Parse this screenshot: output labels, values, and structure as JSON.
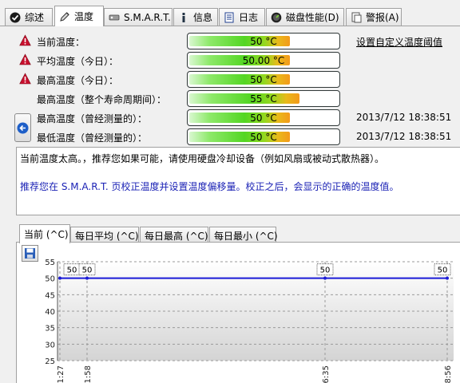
{
  "tabs": [
    {
      "label": "综述",
      "icon": "check-circle-icon",
      "active": false
    },
    {
      "label": "温度",
      "icon": "pencil-icon",
      "active": true
    },
    {
      "label": "S.M.A.R.T.",
      "icon": "drive-icon",
      "active": false
    },
    {
      "label": "信息",
      "icon": "info-icon",
      "active": false
    },
    {
      "label": "日志",
      "icon": "log-icon",
      "active": false
    },
    {
      "label": "磁盘性能(D)",
      "icon": "gauge-icon",
      "active": false
    },
    {
      "label": "警报(A)",
      "icon": "alert-doc-icon",
      "active": false
    }
  ],
  "temperatures": [
    {
      "label": "当前温度：",
      "value": "50 °C",
      "level": 0.68,
      "warning": true,
      "timestamp": ""
    },
    {
      "label": "平均温度（今日）：",
      "value": "50.00 °C",
      "level": 0.68,
      "warning": true,
      "timestamp": ""
    },
    {
      "label": "最高温度（今日）：",
      "value": "50 °C",
      "level": 0.68,
      "warning": true,
      "timestamp": ""
    },
    {
      "label": "最高温度（整个寿命周期间）：",
      "value": "55 °C",
      "level": 0.74,
      "warning": false,
      "timestamp": ""
    },
    {
      "label": "最高温度（曾经测量的）：",
      "value": "50 °C",
      "level": 0.68,
      "warning": false,
      "timestamp": "2013/7/12 18:38:51"
    },
    {
      "label": "最低温度（曾经测量的）：",
      "value": "50 °C",
      "level": 0.68,
      "warning": false,
      "timestamp": "2013/7/12 18:38:51"
    }
  ],
  "threshold_link": "设置自定义温度阈值",
  "message": {
    "line1": "当前温度太高。，推荐您如果可能，请使用硬盘冷却设备（例如风扇或被动式散热器）。",
    "line2": "推荐您在 S.M.A.R.T. 页校正温度并设置温度偏移量。校正之后，会显示的正确的温度值。"
  },
  "chart_tabs": [
    {
      "label": "当前 (^C)",
      "active": true
    },
    {
      "label": "每日平均 (^C)",
      "active": false
    },
    {
      "label": "每日最高 (^C)",
      "active": false
    },
    {
      "label": "每日最小 (^C)",
      "active": false
    }
  ],
  "chart_data": {
    "type": "line",
    "title": "",
    "xlabel": "",
    "ylabel": "",
    "ylim": [
      25,
      55
    ],
    "yticks": [
      25,
      30,
      35,
      40,
      45,
      50,
      55
    ],
    "grid": true,
    "x_labels": [
      "1:27",
      "1:58",
      "6:35",
      "8:56"
    ],
    "series": [
      {
        "values": [
          50,
          50,
          50,
          50
        ],
        "color": "#1a1ad6"
      }
    ],
    "point_labels": [
      "50",
      "50",
      "50",
      "50"
    ]
  },
  "colors": {
    "warning": "#c8102e",
    "line": "#1a1ad6",
    "advice_text": "#1b22b5"
  }
}
